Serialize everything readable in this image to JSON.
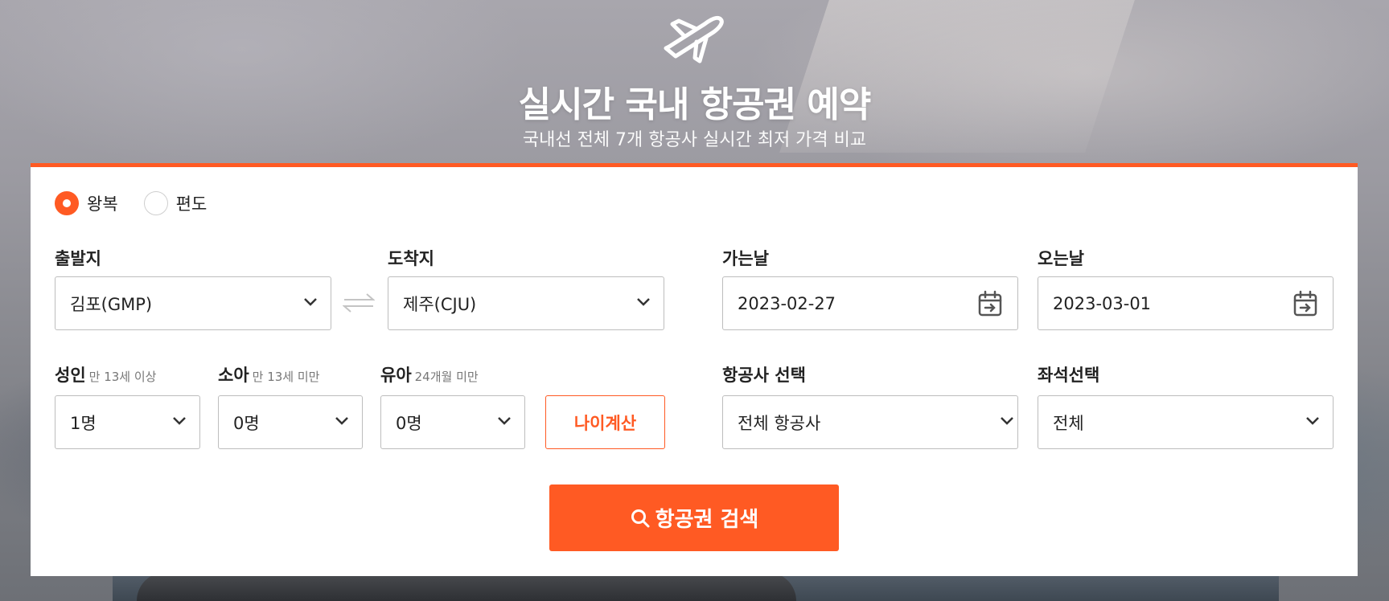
{
  "hero": {
    "title": "실시간 국내 항공권 예약",
    "subtitle": "국내선 전체 7개 항공사 실시간 최저 가격 비교",
    "icon": "airplane-icon"
  },
  "trip_type": {
    "options": [
      {
        "label": "왕복",
        "selected": true
      },
      {
        "label": "편도",
        "selected": false
      }
    ]
  },
  "departure": {
    "label": "출발지",
    "value": "김포(GMP)"
  },
  "arrival": {
    "label": "도착지",
    "value": "제주(CJU)"
  },
  "depart_date": {
    "label": "가는날",
    "value": "2023-02-27"
  },
  "return_date": {
    "label": "오는날",
    "value": "2023-03-01"
  },
  "passengers": {
    "adult": {
      "label": "성인",
      "hint": "만 13세 이상",
      "value": "1명"
    },
    "child": {
      "label": "소아",
      "hint": "만 13세 미만",
      "value": "0명"
    },
    "infant": {
      "label": "유아",
      "hint": "24개월 미만",
      "value": "0명"
    },
    "age_calc_label": "나이계산"
  },
  "airline": {
    "label": "항공사 선택",
    "value": "전체 항공사"
  },
  "seat": {
    "label": "좌석선택",
    "value": "전체"
  },
  "search_button": {
    "label": "항공권 검색"
  },
  "colors": {
    "accent": "#ff5a23",
    "border": "#bdbdbd",
    "text": "#222222"
  }
}
